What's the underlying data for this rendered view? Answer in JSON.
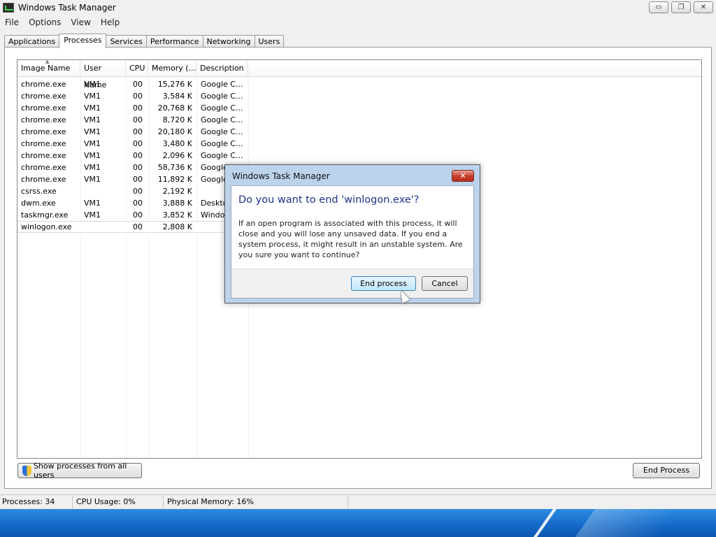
{
  "window": {
    "title": "Windows Task Manager",
    "controls": {
      "minimize": "▭",
      "restore": "❐",
      "close": "✕"
    }
  },
  "menu": [
    "File",
    "Options",
    "View",
    "Help"
  ],
  "tabs": [
    "Applications",
    "Processes",
    "Services",
    "Performance",
    "Networking",
    "Users"
  ],
  "active_tab": "Processes",
  "columns": [
    "Image Name",
    "User Name",
    "CPU",
    "Memory (...",
    "Description"
  ],
  "processes": [
    {
      "name": "chrome.exe",
      "user": "VM1",
      "cpu": "00",
      "memory": "15,276 K",
      "description": "Google C..."
    },
    {
      "name": "chrome.exe",
      "user": "VM1",
      "cpu": "00",
      "memory": "3,584 K",
      "description": "Google C..."
    },
    {
      "name": "chrome.exe",
      "user": "VM1",
      "cpu": "00",
      "memory": "20,768 K",
      "description": "Google C..."
    },
    {
      "name": "chrome.exe",
      "user": "VM1",
      "cpu": "00",
      "memory": "8,720 K",
      "description": "Google C..."
    },
    {
      "name": "chrome.exe",
      "user": "VM1",
      "cpu": "00",
      "memory": "20,180 K",
      "description": "Google C..."
    },
    {
      "name": "chrome.exe",
      "user": "VM1",
      "cpu": "00",
      "memory": "3,480 K",
      "description": "Google C..."
    },
    {
      "name": "chrome.exe",
      "user": "VM1",
      "cpu": "00",
      "memory": "2,096 K",
      "description": "Google C..."
    },
    {
      "name": "chrome.exe",
      "user": "VM1",
      "cpu": "00",
      "memory": "58,736 K",
      "description": "Google"
    },
    {
      "name": "chrome.exe",
      "user": "VM1",
      "cpu": "00",
      "memory": "11,892 K",
      "description": "Google"
    },
    {
      "name": "csrss.exe",
      "user": "",
      "cpu": "00",
      "memory": "2,192 K",
      "description": ""
    },
    {
      "name": "dwm.exe",
      "user": "VM1",
      "cpu": "00",
      "memory": "3,888 K",
      "description": "Deskto"
    },
    {
      "name": "taskmgr.exe",
      "user": "VM1",
      "cpu": "00",
      "memory": "3,852 K",
      "description": "Window"
    },
    {
      "name": "winlogon.exe",
      "user": "",
      "cpu": "00",
      "memory": "2,808 K",
      "description": ""
    }
  ],
  "buttons": {
    "show_all": "Show processes from all users",
    "end_process": "End Process"
  },
  "status": {
    "processes": "Processes: 34",
    "cpu": "CPU Usage: 0%",
    "memory": "Physical Memory: 16%"
  },
  "dialog": {
    "title": "Windows Task Manager",
    "close": "✕",
    "heading": "Do you want to end 'winlogon.exe'?",
    "message": "If an open program is associated with this process, it will close and you will lose any unsaved data. If you end a system process, it might result in an unstable system. Are you sure you want to continue?",
    "confirm": "End process",
    "cancel": "Cancel"
  },
  "colors": {
    "accent": "#1e3287",
    "close_red": "#c7412e",
    "desktop": "#1468c8"
  }
}
